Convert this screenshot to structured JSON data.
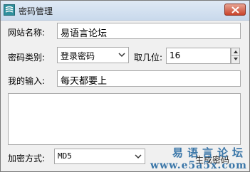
{
  "window": {
    "title": "密码管理",
    "accent": "#3a76a8"
  },
  "site": {
    "label": "网站名称:",
    "value": "易语言论坛"
  },
  "category": {
    "label": "密码类别:",
    "selected": "登录密码"
  },
  "digits": {
    "label": "取几位:",
    "value": "16"
  },
  "input": {
    "label": "我的输入:",
    "value": "每天都要上"
  },
  "output": {
    "value": ""
  },
  "encrypt": {
    "label": "加密方式:",
    "selected": "MD5",
    "button_label": "生成密码"
  },
  "watermark": {
    "line1": "易语言论坛",
    "line2": "www.e5a5x.com"
  }
}
